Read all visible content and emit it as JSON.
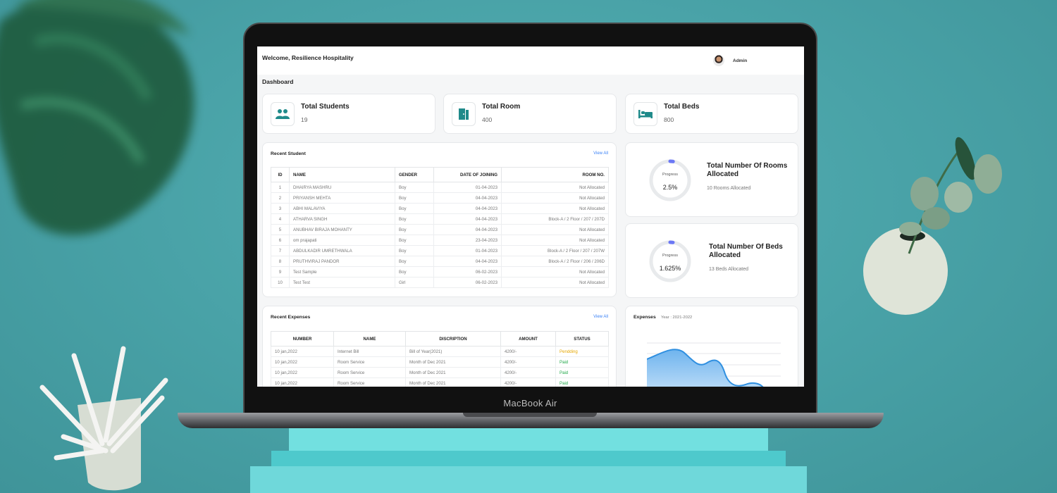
{
  "device": {
    "brand": "MacBook Air"
  },
  "header": {
    "welcome": "Welcome, Resilience Hospitality",
    "user_name": "Admin"
  },
  "page": {
    "title": "Dashboard"
  },
  "stats": [
    {
      "label": "Total Students",
      "value": "19",
      "icon": "users-icon"
    },
    {
      "label": "Total Room",
      "value": "400",
      "icon": "door-icon"
    },
    {
      "label": "Total Beds",
      "value": "800",
      "icon": "bed-icon"
    }
  ],
  "recent_students": {
    "title": "Recent Student",
    "view_all": "View All",
    "columns": [
      "ID",
      "NAME",
      "GENDER",
      "DATE OF JOINING",
      "ROOM NO."
    ],
    "rows": [
      [
        "1",
        "DHAIRYA MASHRU",
        "Boy",
        "01-04-2023",
        "Not Allocated"
      ],
      [
        "2",
        "PRIYANSH MEHTA",
        "Boy",
        "04-04-2023",
        "Not Allocated"
      ],
      [
        "3",
        "ABHI MALAVIYA",
        "Boy",
        "04-04-2023",
        "Not Allocated"
      ],
      [
        "4",
        "ATHARVA SINGH",
        "Boy",
        "04-04-2023",
        "Block-A / 2 Floor / 207 / 207D"
      ],
      [
        "5",
        "ANUBHAV BIRAJA MOHANTY",
        "Boy",
        "04-04-2023",
        "Not Allocated"
      ],
      [
        "6",
        "om prajapati",
        "Boy",
        "23-04-2023",
        "Not Allocated"
      ],
      [
        "7",
        "ABDULKADIR UMRETHWALA",
        "Boy",
        "01-04-2023",
        "Block-A / 2 Floor / 207 / 207W"
      ],
      [
        "8",
        "PRUTHVIRAJ PANDOR",
        "Boy",
        "04-04-2023",
        "Block-A / 2 Floor / 206 / 206D"
      ],
      [
        "9",
        "Test Sample",
        "Boy",
        "06-02-2023",
        "Not Allocated"
      ],
      [
        "10",
        "Test Test",
        "Girl",
        "06-02-2023",
        "Not Allocated"
      ]
    ]
  },
  "rooms_allocated": {
    "progress_label": "Progress",
    "progress_value": "2.5%",
    "progress_fraction": 0.025,
    "title": "Total Number Of Rooms Allocated",
    "subtitle": "10 Rooms Allocated"
  },
  "beds_allocated": {
    "progress_label": "Progress",
    "progress_value": "1.625%",
    "progress_fraction": 0.01625,
    "title": "Total Number Of Beds Allocated",
    "subtitle": "13 Beds Allocated"
  },
  "recent_expenses": {
    "title": "Recent Expenses",
    "view_all": "View All",
    "columns": [
      "NUMBER",
      "NAME",
      "DISCRIPTION",
      "AMOUNT",
      "STATUS"
    ],
    "rows": [
      [
        "10 jan,2022",
        "Internet Bill",
        "Bill of Year(2021)",
        "4200/-",
        "Pendding"
      ],
      [
        "10 jan,2022",
        "Room Service",
        "Month of Dec 2021",
        "4200/-",
        "Paid"
      ],
      [
        "10 jan,2022",
        "Room Service",
        "Month of Dec 2021",
        "4200/-",
        "Paid"
      ],
      [
        "10 jan,2022",
        "Room Service",
        "Month of Dec 2021",
        "4200/-",
        "Paid"
      ]
    ]
  },
  "expenses_chart": {
    "title": "Expenses",
    "year": "Year : 2021-2022",
    "colors": {
      "line": "#2f8fe0",
      "fill_top": "#6fb4ee",
      "fill_bottom": "#cfe6fa"
    }
  },
  "colors": {
    "accent": "#1f8a8a",
    "link": "#3b82f6",
    "progress": "#6b78f5",
    "ring": "#e8eaec"
  }
}
